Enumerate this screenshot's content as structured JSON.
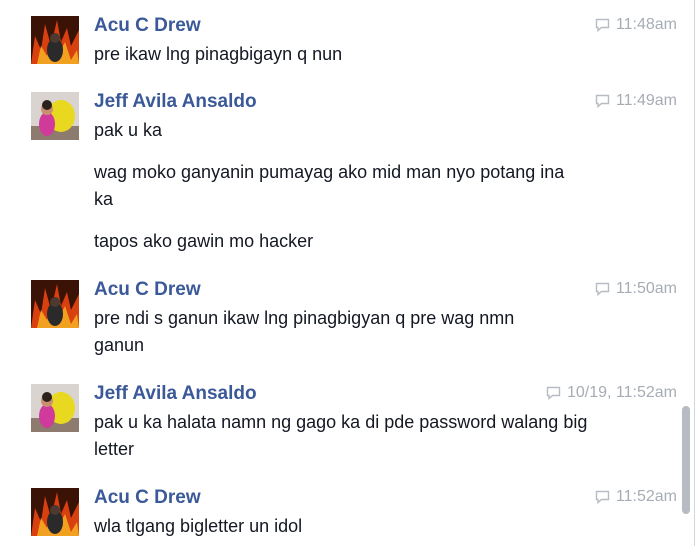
{
  "messages": [
    {
      "sender": "Acu C Drew",
      "avatar": "fire-portrait",
      "time": "11:48am",
      "texts": [
        "pre ikaw lng pinagbigayn q nun"
      ]
    },
    {
      "sender": "Jeff Avila Ansaldo",
      "avatar": "child-with-toy",
      "time": "11:49am",
      "texts": [
        "pak u ka",
        "wag moko ganyanin pumayag ako mid man nyo potang ina ka",
        "tapos ako gawin mo hacker"
      ]
    },
    {
      "sender": "Acu C Drew",
      "avatar": "fire-portrait",
      "time": "11:50am",
      "texts": [
        "pre ndi s ganun ikaw lng pinagbigyan q pre wag nmn ganun"
      ]
    },
    {
      "sender": "Jeff Avila Ansaldo",
      "avatar": "child-with-toy",
      "time": "10/19, 11:52am",
      "texts": [
        "pak u ka halata namn ng gago ka di pde password walang big letter"
      ]
    },
    {
      "sender": "Acu C Drew",
      "avatar": "fire-portrait",
      "time": "11:52am",
      "texts": [
        "wla tlgang bigletter un idol"
      ]
    }
  ],
  "colors": {
    "sender": "#3b5998",
    "text": "#141823",
    "timestamp": "#a7acb5"
  },
  "icons": {
    "timestamp": "chat-bubble-icon"
  }
}
